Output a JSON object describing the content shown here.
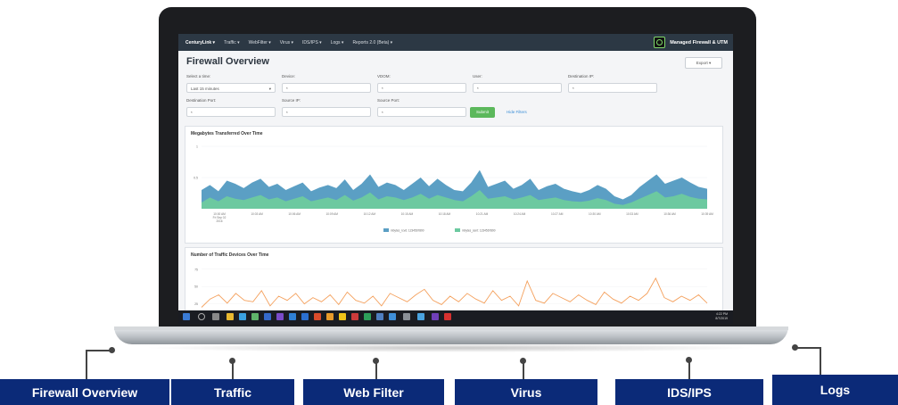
{
  "screen": {
    "nav": {
      "items": [
        "CenturyLink ▾",
        "Traffic ▾",
        "WebFilter ▾",
        "Virus ▾",
        "IDS/IPS ▾",
        "Logs ▾",
        "Reports 2.0 (Beta) ▾"
      ],
      "brand": "Managed Firewall & UTM"
    },
    "page_title": "Firewall Overview",
    "export_label": "Export ▾",
    "filters": {
      "time_label": "Select a time:",
      "time_value": "Last 15 minutes",
      "device_label": "Device:",
      "device_value": "*",
      "vdom_label": "VDOM:",
      "vdom_value": "*",
      "user_label": "User:",
      "user_value": "*",
      "dest_ip_label": "Destination IP:",
      "dest_ip_value": "*",
      "dest_port_label": "Destination Port:",
      "dest_port_value": "*",
      "source_ip_label": "Source IP:",
      "source_ip_value": "*",
      "source_port_label": "Source Port:",
      "source_port_value": "*",
      "submit_label": "Submit",
      "hide_filters_label": "Hide Filters"
    },
    "taskbar_clock": [
      "4:22 PM",
      "8/7/2019"
    ]
  },
  "chart_data": [
    {
      "type": "area",
      "title": "Megabytes Transferred Over Time",
      "ylim": [
        0,
        1
      ],
      "yticks": [
        "1",
        "0.5"
      ],
      "x": [
        "10:00 AM",
        "10:03 AM",
        "10:06 AM",
        "10:09 AM",
        "10:12 AM",
        "10:15 AM",
        "10:18 AM",
        "10:21 AM",
        "10:24 AM",
        "10:27 AM",
        "10:30 AM",
        "10:33 AM",
        "10:36 AM",
        "10:39 AM"
      ],
      "x_first_sublabel": [
        "Fri Sep 02",
        "2016"
      ],
      "series": [
        {
          "name": "mbytes_rcvd: 1234567890",
          "color": "#5b9fc4",
          "values": [
            0.3,
            0.38,
            0.28,
            0.45,
            0.4,
            0.33,
            0.42,
            0.48,
            0.35,
            0.4,
            0.3,
            0.36,
            0.42,
            0.28,
            0.34,
            0.38,
            0.33,
            0.47,
            0.3,
            0.4,
            0.55,
            0.35,
            0.42,
            0.38,
            0.3,
            0.4,
            0.5,
            0.36,
            0.48,
            0.38,
            0.3,
            0.28,
            0.42,
            0.62,
            0.35,
            0.4,
            0.45,
            0.32,
            0.38,
            0.48,
            0.3,
            0.36,
            0.4,
            0.32,
            0.28,
            0.25,
            0.3,
            0.38,
            0.32,
            0.2,
            0.15,
            0.22,
            0.35,
            0.45,
            0.55,
            0.4,
            0.45,
            0.5,
            0.42,
            0.35,
            0.32
          ]
        },
        {
          "name": "mbytes_sent: 1234567890",
          "color": "#6cc9a0",
          "values": [
            0.1,
            0.18,
            0.12,
            0.2,
            0.16,
            0.14,
            0.18,
            0.22,
            0.15,
            0.18,
            0.12,
            0.16,
            0.2,
            0.12,
            0.15,
            0.18,
            0.14,
            0.22,
            0.13,
            0.18,
            0.26,
            0.15,
            0.2,
            0.18,
            0.14,
            0.18,
            0.24,
            0.16,
            0.22,
            0.18,
            0.14,
            0.12,
            0.2,
            0.3,
            0.16,
            0.18,
            0.2,
            0.15,
            0.18,
            0.22,
            0.14,
            0.16,
            0.18,
            0.14,
            0.12,
            0.11,
            0.13,
            0.17,
            0.14,
            0.08,
            0.06,
            0.1,
            0.16,
            0.22,
            0.28,
            0.18,
            0.2,
            0.24,
            0.19,
            0.16,
            0.15
          ]
        }
      ]
    },
    {
      "type": "line",
      "title": "Number of Traffic Devices Over Time",
      "yticks": [
        "75",
        "50",
        "25"
      ],
      "series": [
        {
          "color": "#f4a05c",
          "values": [
            20,
            32,
            38,
            26,
            40,
            30,
            28,
            44,
            22,
            36,
            30,
            40,
            25,
            34,
            28,
            38,
            24,
            42,
            30,
            26,
            36,
            22,
            40,
            34,
            28,
            38,
            46,
            30,
            24,
            36,
            28,
            40,
            32,
            26,
            44,
            30,
            36,
            22,
            58,
            30,
            26,
            40,
            34,
            28,
            38,
            30,
            24,
            42,
            32,
            26,
            36,
            30,
            40,
            62,
            34,
            28,
            36,
            30,
            38,
            26
          ]
        }
      ]
    }
  ],
  "tags": [
    {
      "label": "Firewall Overview"
    },
    {
      "label": "Traffic"
    },
    {
      "label": "Web Filter"
    },
    {
      "label": "Virus"
    },
    {
      "label": "IDS/IPS"
    },
    {
      "label": "Logs"
    }
  ],
  "colors": {
    "tag_bg": "#0b2a78",
    "nav_bg": "#2c3844",
    "submit": "#5cb85c"
  }
}
